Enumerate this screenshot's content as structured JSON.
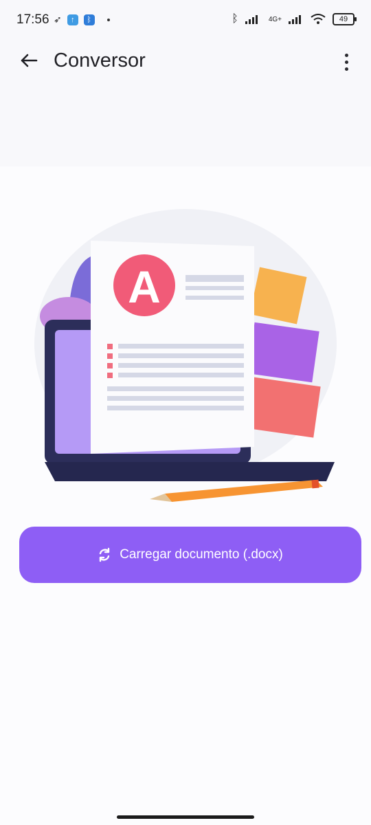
{
  "status_bar": {
    "time": "17:56",
    "network": "4G+",
    "battery": "49"
  },
  "app_bar": {
    "title": "Conversor"
  },
  "illustration": {
    "document_letter": "A"
  },
  "primary_action": {
    "label": "Carregar documento (.docx)",
    "icon": "sync-icon",
    "color": "#8e5ef5"
  },
  "colors": {
    "accent": "#8e5ef5",
    "background": "#f8f8fb"
  }
}
